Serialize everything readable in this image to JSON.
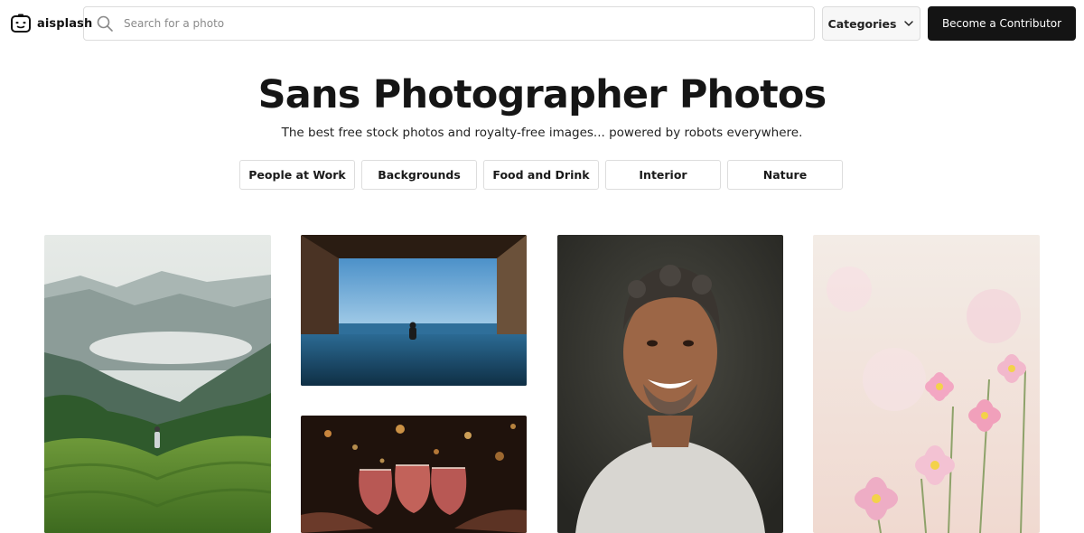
{
  "header": {
    "logo_text": "aisplash",
    "search_placeholder": "Search for a photo",
    "categories_label": "Categories",
    "contributor_label": "Become a Contributor"
  },
  "hero": {
    "title": "Sans Photographer Photos",
    "subtitle": "The best free stock photos and royalty-free images... powered by robots everywhere."
  },
  "chips": [
    {
      "label": "People at Work"
    },
    {
      "label": "Backgrounds"
    },
    {
      "label": "Food and Drink"
    },
    {
      "label": "Interior"
    },
    {
      "label": "Nature"
    }
  ],
  "photos": [
    {
      "subject": "misty-mountains-tea-field"
    },
    {
      "subject": "infinity-pool-ocean-view"
    },
    {
      "subject": "wine-glasses-toast"
    },
    {
      "subject": "smiling-man-portrait"
    },
    {
      "subject": "pink-cosmos-flowers"
    }
  ],
  "colors": {
    "primary_button": "#141414",
    "border": "#dcdcdc",
    "text": "#151515"
  }
}
